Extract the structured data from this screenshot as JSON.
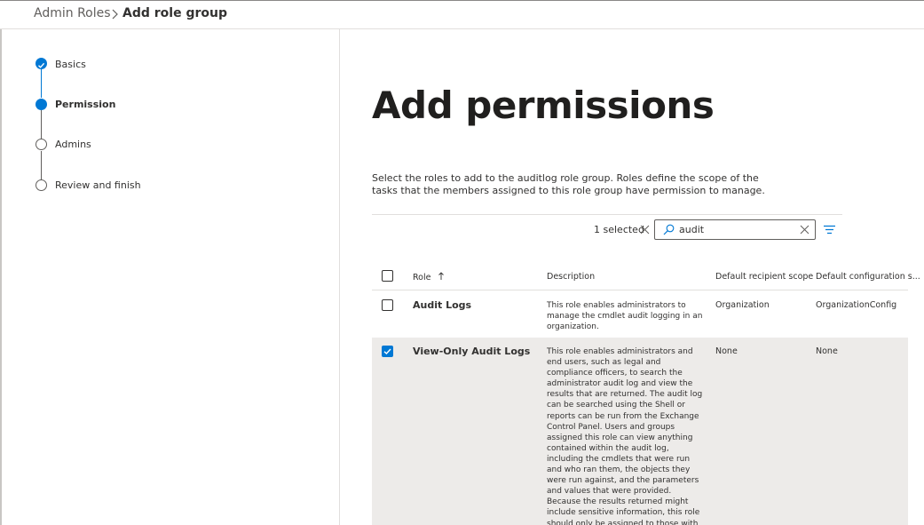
{
  "breadcrumb": {
    "root": "Admin Roles",
    "current": "Add role group"
  },
  "steps": [
    {
      "label": "Basics",
      "state": "done"
    },
    {
      "label": "Permission",
      "state": "current"
    },
    {
      "label": "Admins",
      "state": "todo"
    },
    {
      "label": "Review and finish",
      "state": "todo"
    }
  ],
  "main": {
    "title": "Add permissions",
    "intro": "Select the roles to add to the auditlog role group. Roles define the scope of the tasks that the members assigned to this role group have permission to manage."
  },
  "toolbar": {
    "selected_count": "1 selected",
    "search_value": "audit"
  },
  "table": {
    "columns": {
      "role": "Role",
      "description": "Description",
      "recipient_scope": "Default recipient scope",
      "config_scope": "Default configuration s..."
    },
    "rows": [
      {
        "role": "Audit Logs",
        "description": "This role enables administrators to manage the cmdlet audit logging in an organization.",
        "recipient_scope": "Organization",
        "config_scope": "OrganizationConfig",
        "checked": false
      },
      {
        "role": "View-Only Audit Logs",
        "description": "This role enables administrators and end users, such as legal and compliance officers, to search the administrator audit log and view the results that are returned. The audit log can be searched using the Shell or reports can be run from the Exchange Control Panel. Users and groups assigned this role can view anything contained within the audit log, including the cmdlets that were run and who ran them, the objects they were run against, and the parameters and values that were provided. Because the results returned might include sensitive information, this role should only be assigned to those with an explicit need to view the information.",
        "recipient_scope": "None",
        "config_scope": "None",
        "checked": true
      }
    ]
  },
  "colors": {
    "accent": "#0078d4",
    "selected_row": "#edebe9",
    "text": "#323130"
  }
}
